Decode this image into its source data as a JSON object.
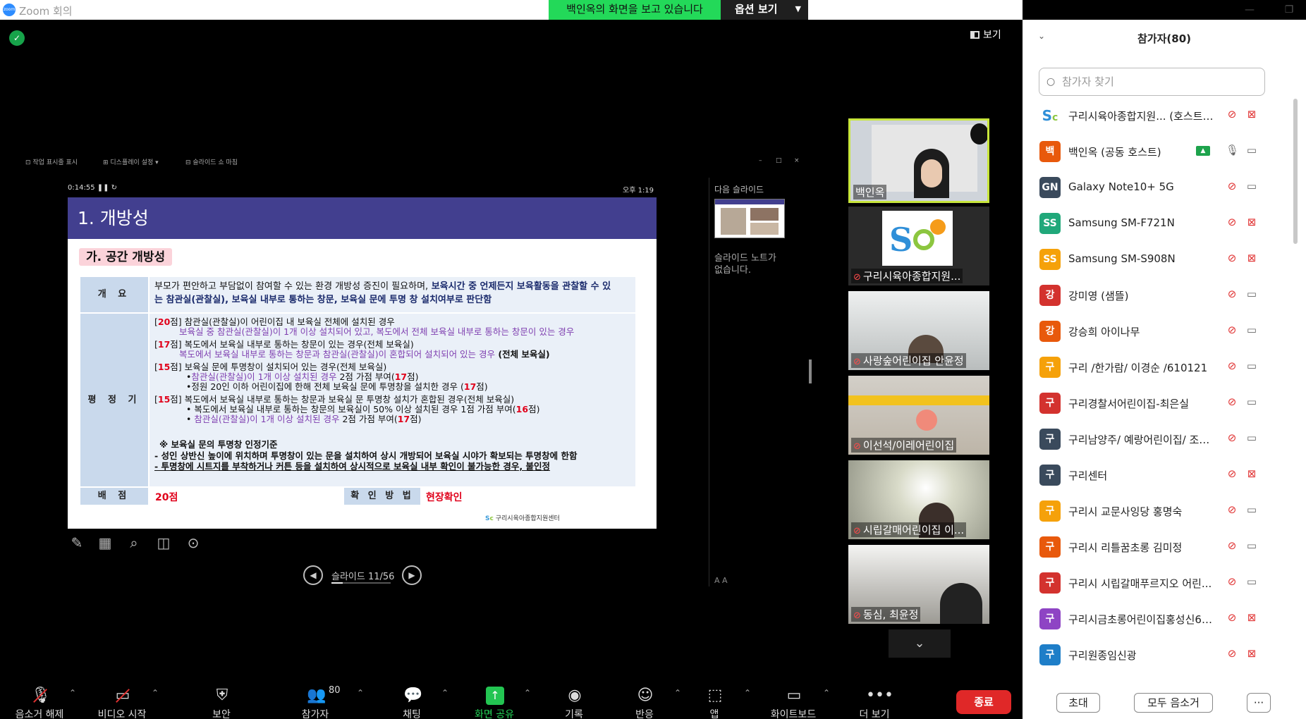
{
  "window": {
    "title": "Zoom 회의",
    "logo": "zoom",
    "minimize": "—",
    "restore": "❐"
  },
  "share_banner": {
    "viewing": "백인옥의 화면을 보고 있습니다",
    "options": "옵션 보기"
  },
  "view_button": "보기",
  "presenter": {
    "menu": [
      "작업 표시줄 표시",
      "디스플레이 설정 ▾",
      "슬라이드 쇼 마침"
    ],
    "timer": "0:14:55",
    "clock": "오후 1:19",
    "next_slide_label": "다음 슬라이드",
    "notes": "슬라이드 노트가 없습니다.",
    "slide_counter": "슬라이드 11/56",
    "font_controls": "A  A"
  },
  "slide": {
    "title": "1. 개방성",
    "subtitle": "가. 공간 개방성",
    "overview_label": "개 요",
    "overview_text1": "부모가 편안하고 부담없이 참여할 수 있는 환경 개방성 증진이 필요하며,",
    "overview_text1b": " 보육시간 중 언제든지 보육활동을 관찰할 수 있",
    "overview_text2": "는 참관실(관찰실), 보육실 내부로 통하는 창문, 보육실 문에 투명 창 설치여부로 판단함",
    "criteria_label": "평 정 기 준",
    "c20_pts": "20",
    "c20_main": "점] 참관실(관찰실)이 어린이집 내 보육실 전체에 설치된 경우",
    "c20_sub": "보육실 중 참관실(관찰실)이 1개 이상 설치되어 있고, 복도에서 전체 보육실 내부로 통하는 창문이 있는 경우",
    "c17_pts": "17",
    "c17_main": "점] 복도에서 보육실 내부로 통하는 창문이 있는 경우(전체 보육실)",
    "c17_sub": "복도에서 보육실 내부로 통하는 창문과 참관실(관찰실)이 혼합되어 설치되어 있는 경우",
    "c17_sub_tail": " (전체 보육실)",
    "c15a_pts": "15",
    "c15a_main": "점] 보육실 문에 투명창이 설치되어 있는 경우(전체 보육실)",
    "c15a_b1": "참관실(관찰실)이 1개 이상 설치된 경우",
    "c15a_b1_tail": " 2점 가점 부여(",
    "c15a_b1_pts": "17",
    "c15a_b2": "•정원 20인 이하 어린이집에 한해 전체 보육실 문에 투명창을 설치한 경우 (",
    "c15a_b2_pts": "17",
    "c15a_b2_tail": "점)",
    "c15b_pts": "15",
    "c15b_main": "점] 복도에서 보육실 내부로 통하는 창문과 보육실 문 투명창 설치가 혼합된 경우(전체 보육실)",
    "c15b_b1": "• 복도에서 보육실 내부로 통하는 창문의 보육실이 50% 이상 설치된 경우 1점 가점 부여(",
    "c15b_b1_pts": "16",
    "c15b_b2": "참관실(관찰실)이 1개 이상 설치된 경우",
    "c15b_b2_tail": " 2점 가점 부여(",
    "c15b_b2_pts": "17",
    "note_title": "※ 보육실 문의 투명창 인정기준",
    "note1": "- 성인 상반신 높이에 위치하며 투명창이 있는 문을 설치하여 상시 개방되어 보육실 시야가 확보되는 투명창에 한함",
    "note2": "- 투명창에 시트지를 부착하거나 커튼 등을 설치하여 상시적으로 보육실 내부 확인이 불가능한 경우, 불인정",
    "score_label": "배 점",
    "score": "20점",
    "check_label": "확 인 방 법",
    "check_value": "현장확인",
    "footer_logo": "구리시육아종합지원센터"
  },
  "videos": [
    {
      "name": "백인옥",
      "muted": false,
      "active": true
    },
    {
      "name": "구리시육아종합지원...",
      "muted": true
    },
    {
      "name": "사랑숲어린이집 안윤정",
      "muted": true
    },
    {
      "name": "이선석/이레어린이집",
      "muted": true
    },
    {
      "name": "시립갈매어린이집 이...",
      "muted": true
    },
    {
      "name": "동심, 최윤정",
      "muted": true
    }
  ],
  "toolbar": [
    {
      "label": "음소거 해제",
      "icon": "mic-off-icon"
    },
    {
      "label": "비디오 시작",
      "icon": "video-off-icon"
    },
    {
      "label": "보안",
      "icon": "shield-icon"
    },
    {
      "label": "참가자",
      "icon": "participants-icon",
      "count": "80"
    },
    {
      "label": "채팅",
      "icon": "chat-icon"
    },
    {
      "label": "화면 공유",
      "icon": "share-screen-icon"
    },
    {
      "label": "기록",
      "icon": "record-icon"
    },
    {
      "label": "반응",
      "icon": "reactions-icon"
    },
    {
      "label": "앱",
      "icon": "apps-icon"
    },
    {
      "label": "화이트보드",
      "icon": "whiteboard-icon"
    },
    {
      "label": "더 보기",
      "icon": "more-icon"
    }
  ],
  "end_button": "종료",
  "participants_panel": {
    "title": "참가자(80)",
    "search_placeholder": "참가자 찾기",
    "participants": [
      {
        "initial": "",
        "name": "구리시육아종합지원... (호스트, 나)",
        "color": "#ffffff",
        "mic_muted": true,
        "cam_off": true,
        "logo": true
      },
      {
        "initial": "백",
        "name": "백인옥 (공동 호스트)",
        "color": "#e8590c",
        "mic_muted": false,
        "cam_off": false,
        "sharing": true
      },
      {
        "initial": "GN",
        "name": "Galaxy Note10+ 5G",
        "color": "#3a4a5c",
        "mic_muted": true,
        "cam_off": false
      },
      {
        "initial": "SS",
        "name": "Samsung SM-F721N",
        "color": "#20a87a",
        "mic_muted": true,
        "cam_off": true
      },
      {
        "initial": "SS",
        "name": "Samsung SM-S908N",
        "color": "#f5a10a",
        "mic_muted": true,
        "cam_off": true
      },
      {
        "initial": "강",
        "name": "강미영 (샘뜰)",
        "color": "#d3322e",
        "mic_muted": true,
        "cam_off": false
      },
      {
        "initial": "강",
        "name": "강승희 아이나무",
        "color": "#e8590c",
        "mic_muted": true,
        "cam_off": false
      },
      {
        "initial": "구",
        "name": "구리 /한가람/ 이경순 /610121",
        "color": "#f5a10a",
        "mic_muted": true,
        "cam_off": false
      },
      {
        "initial": "구",
        "name": "구리경찰서어린이집-최은실",
        "color": "#d3322e",
        "mic_muted": true,
        "cam_off": false
      },
      {
        "initial": "구",
        "name": "구리남양주/ 예랑어린이집/ 조연...",
        "color": "#3a4a5c",
        "mic_muted": true,
        "cam_off": false
      },
      {
        "initial": "구",
        "name": "구리센터",
        "color": "#3a4a5c",
        "mic_muted": true,
        "cam_off": true
      },
      {
        "initial": "구",
        "name": "구리시 교문사잉당 홍명숙",
        "color": "#f5a10a",
        "mic_muted": true,
        "cam_off": false
      },
      {
        "initial": "구",
        "name": "구리시 리틀꿈초롱 김미정",
        "color": "#e8590c",
        "mic_muted": true,
        "cam_off": false
      },
      {
        "initial": "구",
        "name": "구리시 시립갈매푸르지오 어린...",
        "color": "#d3322e",
        "mic_muted": true,
        "cam_off": false
      },
      {
        "initial": "구",
        "name": "구리시금초롱어린이집홍성신60...",
        "color": "#8e44c4",
        "mic_muted": true,
        "cam_off": true
      },
      {
        "initial": "구",
        "name": "구리원종임신광",
        "color": "#1e7ec8",
        "mic_muted": true,
        "cam_off": true
      }
    ],
    "invite": "초대",
    "mute_all": "모두 음소거",
    "more": "···"
  }
}
